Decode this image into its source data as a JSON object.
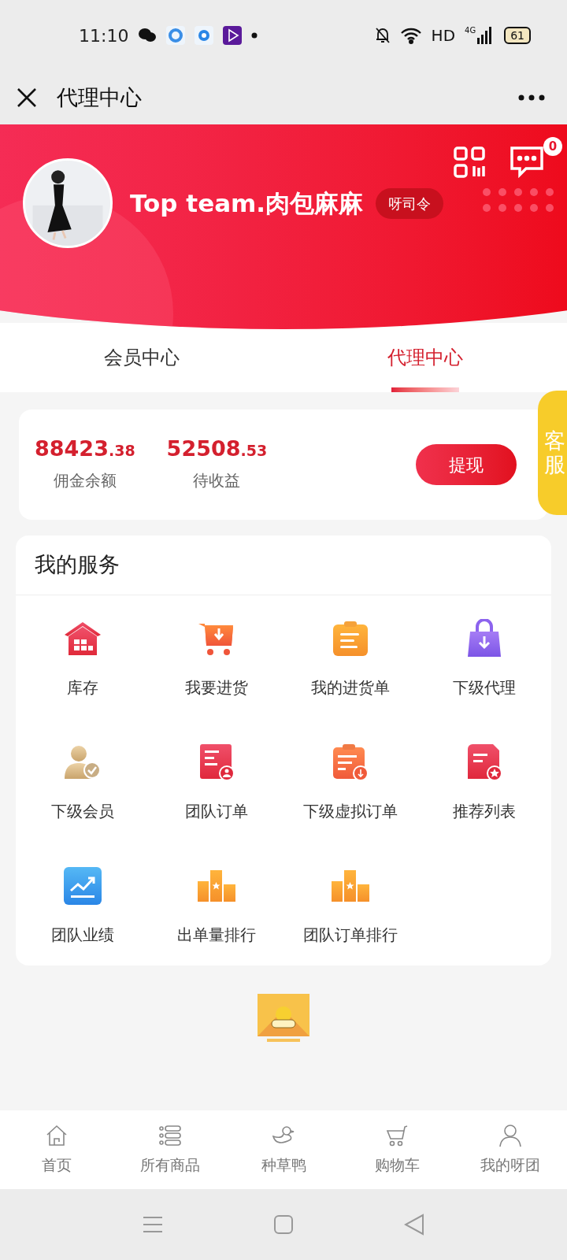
{
  "status_bar": {
    "time": "11:10",
    "battery": "61",
    "network": "4G",
    "hd": "HD"
  },
  "header": {
    "title": "代理中心"
  },
  "profile": {
    "name": "Top team.肉包麻麻",
    "role": "呀司令",
    "message_count": "0"
  },
  "tabs": [
    {
      "label": "会员中心",
      "selected": false
    },
    {
      "label": "代理中心",
      "selected": true
    }
  ],
  "balance": {
    "items": [
      {
        "whole": "88423",
        "cents": ".38",
        "label": "佣金余额"
      },
      {
        "whole": "52508",
        "cents": ".53",
        "label": "待收益"
      }
    ],
    "button": "提现"
  },
  "support_tab": "客服",
  "services": {
    "title": "我的服务",
    "items": [
      {
        "label": "库存"
      },
      {
        "label": "我要进货"
      },
      {
        "label": "我的进货单"
      },
      {
        "label": "下级代理"
      },
      {
        "label": "下级会员"
      },
      {
        "label": "团队订单"
      },
      {
        "label": "下级虚拟订单"
      },
      {
        "label": "推荐列表"
      },
      {
        "label": "团队业绩"
      },
      {
        "label": "出单量排行"
      },
      {
        "label": "团队订单排行"
      }
    ]
  },
  "bottom_nav": [
    {
      "label": "首页"
    },
    {
      "label": "所有商品"
    },
    {
      "label": "种草鸭"
    },
    {
      "label": "购物车"
    },
    {
      "label": "我的呀团"
    }
  ]
}
